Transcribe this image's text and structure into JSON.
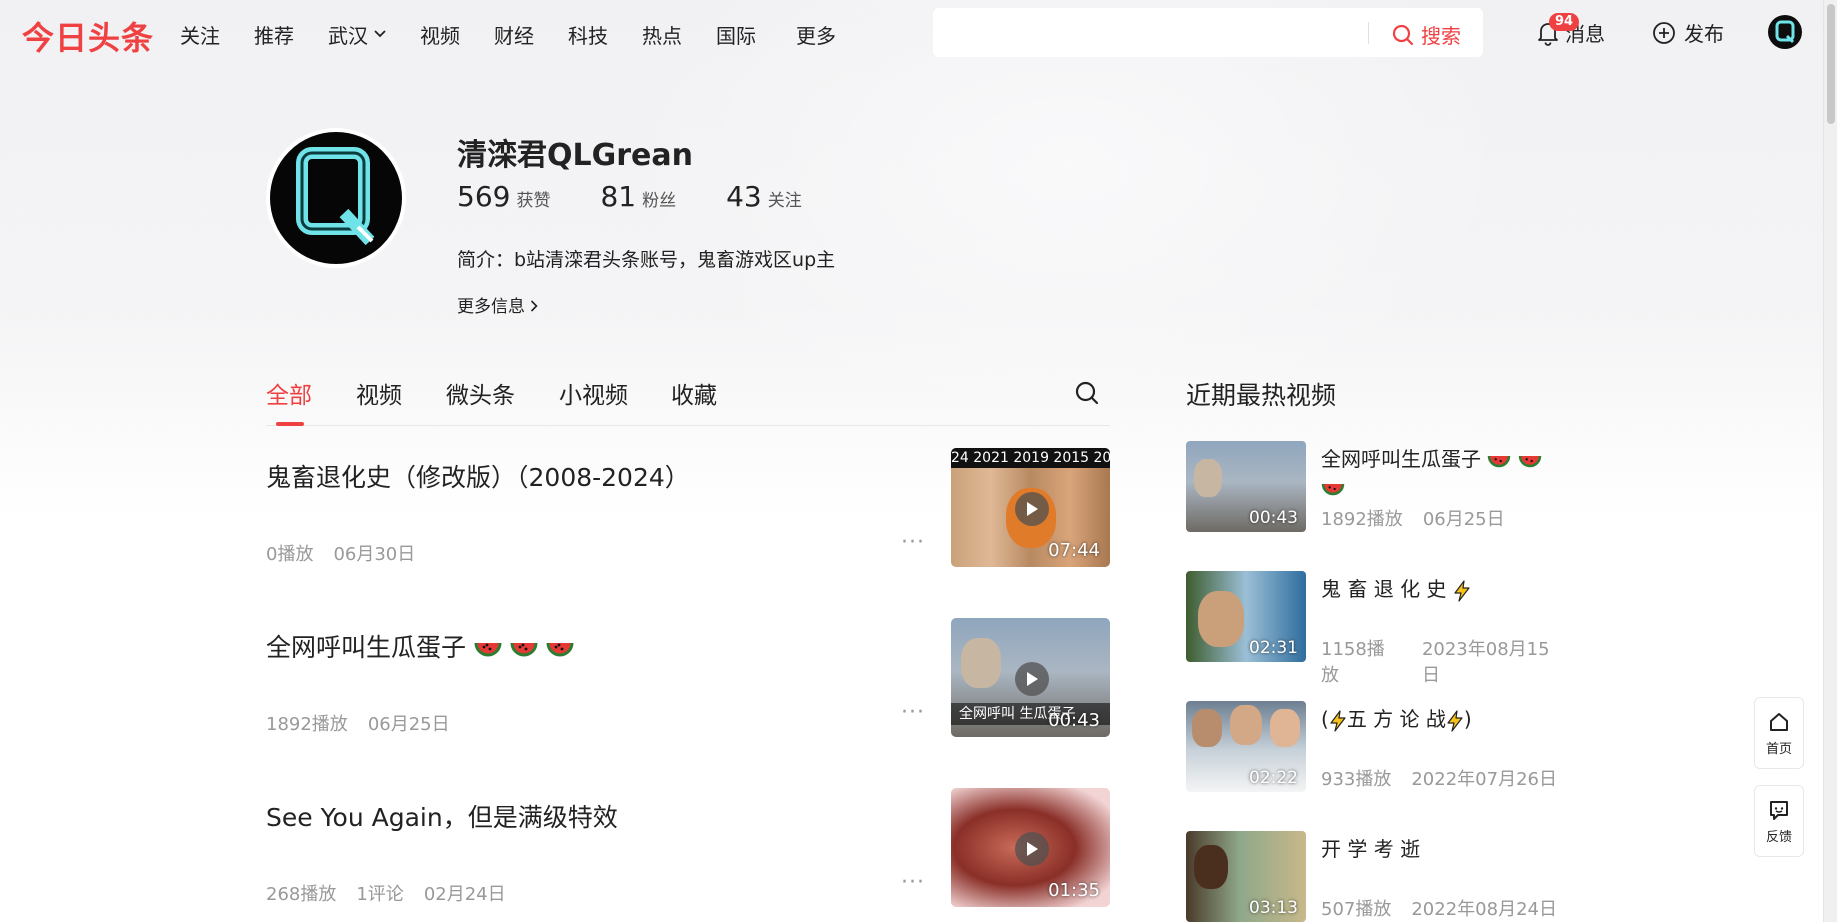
{
  "header": {
    "logo": "今日头条",
    "nav": [
      "关注",
      "推荐",
      "武汉",
      "视频",
      "财经",
      "科技",
      "热点",
      "国际",
      "更多"
    ],
    "search_placeholder": "",
    "search_label": "搜索",
    "notification_count": "94",
    "messages_label": "消息",
    "publish_label": "发布"
  },
  "profile": {
    "name": "清滦君QLGrean",
    "likes_count": "569",
    "likes_label": "获赞",
    "fans_count": "81",
    "fans_label": "粉丝",
    "following_count": "43",
    "following_label": "关注",
    "bio": "简介：b站清滦君头条账号，鬼畜游戏区up主",
    "more_info": "更多信息"
  },
  "tabs": [
    "全部",
    "视频",
    "微头条",
    "小视频",
    "收藏"
  ],
  "feed": [
    {
      "title": "鬼畜退化史（修改版）（2008-2024）",
      "plays": "0播放",
      "comments": "",
      "date": "06月30日",
      "duration": "07:44",
      "thumb_text": "24 2021 2019 2015 20"
    },
    {
      "title": "全网呼叫生瓜蛋子",
      "plays": "1892播放",
      "comments": "",
      "date": "06月25日",
      "duration": "00:43",
      "thumb_text": "全网呼叫 生瓜蛋子"
    },
    {
      "title": "See You Again，但是满级特效",
      "plays": "268播放",
      "comments": "1评论",
      "date": "02月24日",
      "duration": "01:35",
      "thumb_text": ""
    }
  ],
  "sidebar": {
    "title": "近期最热视频",
    "items": [
      {
        "title": "全网呼叫生瓜蛋子",
        "plays": "1892播放",
        "date": "06月25日",
        "duration": "00:43"
      },
      {
        "title": "鬼 畜 退 化 史",
        "plays": "1158播放",
        "date": "2023年08月15日",
        "duration": "02:31"
      },
      {
        "title_pre": "(",
        "title_mid": "五 方 论 战",
        "title_post": ")",
        "plays": "933播放",
        "date": "2022年07月26日",
        "duration": "02:22"
      },
      {
        "title": "开 学 考 逝",
        "plays": "507播放",
        "date": "2022年08月24日",
        "duration": "03:13"
      }
    ]
  },
  "floating": {
    "home": "首页",
    "feedback": "反馈"
  },
  "icons": [
    "search-icon",
    "bell-icon",
    "plus-circle-icon",
    "home-icon",
    "feedback-icon",
    "play-icon",
    "chevron-down-icon",
    "chevron-right-icon",
    "watermelon-icon",
    "lightning-icon"
  ],
  "colors": {
    "brand": "#f04142",
    "text": "#222222",
    "meta": "#999999"
  }
}
